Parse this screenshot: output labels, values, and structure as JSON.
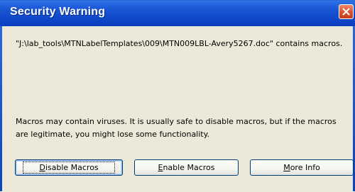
{
  "window": {
    "title": "Security Warning"
  },
  "message": {
    "line1": "\"J:\\lab_tools\\MTNLabelTemplates\\009\\MTN009LBL-Avery5267.doc\" contains macros.",
    "line2": "Macros may contain viruses. It is usually safe to disable macros, but if the macros are legitimate, you might lose some functionality."
  },
  "buttons": {
    "disable": {
      "accel": "D",
      "rest": "isable Macros"
    },
    "enable": {
      "accel": "E",
      "rest": "nable Macros"
    },
    "info": {
      "accel": "M",
      "rest": "ore Info"
    }
  },
  "colors": {
    "titlebar": "#0d45c6",
    "dialog_bg": "#ece9d8",
    "close_button": "#d6502e"
  },
  "icons": {
    "close": "close-icon"
  }
}
